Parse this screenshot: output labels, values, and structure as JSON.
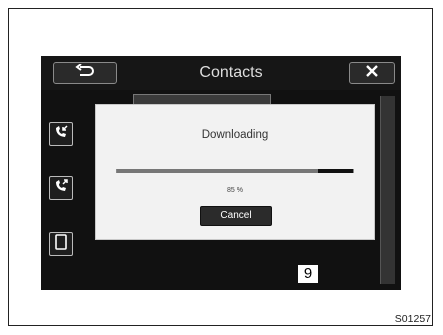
{
  "header": {
    "title": "Contacts",
    "back_icon": "back-arrow-icon",
    "close_icon": "close-x-icon"
  },
  "side_buttons": [
    {
      "icon": "missed-call-icon"
    },
    {
      "icon": "outgoing-call-icon"
    },
    {
      "icon": "phone-device-icon"
    }
  ],
  "dialog": {
    "title": "Downloading",
    "progress_percent": 85,
    "progress_text": "85 %",
    "cancel_label": "Cancel"
  },
  "annotation": {
    "callout_number": "9",
    "figure_code": "S01257"
  },
  "colors": {
    "screen_bg": "#111111",
    "dialog_bg": "#f2f2f2",
    "button_dark": "#2b2b2b"
  }
}
